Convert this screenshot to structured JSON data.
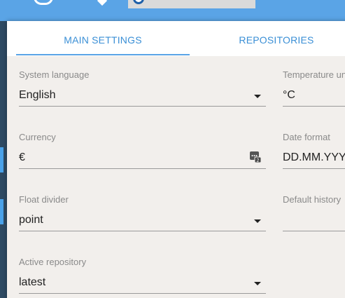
{
  "tabs": [
    {
      "label": "MAIN SETTINGS",
      "active": true
    },
    {
      "label": "REPOSITORIES",
      "active": false
    }
  ],
  "fields": {
    "system_language": {
      "label": "System language",
      "value": "English"
    },
    "temperature": {
      "label": "Temperature units",
      "value": "°C"
    },
    "currency": {
      "label": "Currency",
      "value": "€"
    },
    "date_format": {
      "label": "Date format",
      "value": "DD.MM.YYYY"
    },
    "float_divider": {
      "label": "Float divider",
      "value": "point"
    },
    "default_history": {
      "label": "Default history",
      "value": ""
    },
    "active_repository": {
      "label": "Active repository",
      "value": "latest"
    }
  },
  "colors": {
    "accent": "#3a8fd6",
    "topbar": "#5aa4e6",
    "dialog_bg": "#f2efec"
  }
}
